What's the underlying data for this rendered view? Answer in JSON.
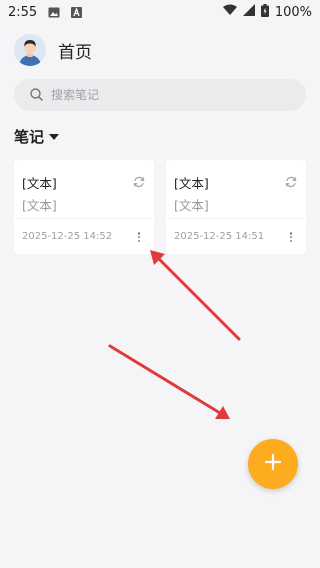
{
  "status_bar": {
    "time": "2:55",
    "battery": "100%"
  },
  "header": {
    "title": "首页"
  },
  "search": {
    "placeholder": "搜索笔记"
  },
  "section": {
    "title": "笔记"
  },
  "notes": [
    {
      "title": "[文本]",
      "body": "[文本]",
      "date": "2025-12-25 14:52"
    },
    {
      "title": "[文本]",
      "body": "[文本]",
      "date": "2025-12-25 14:51"
    }
  ],
  "colors": {
    "accent": "#fdab1f",
    "annotation_arrow": "#e03a3a"
  },
  "icons": [
    "image-icon",
    "a-icon",
    "wifi-icon",
    "signal-icon",
    "battery-icon",
    "avatar",
    "search-icon",
    "caret-down-icon",
    "sync-icon",
    "more-vert-icon",
    "plus-icon"
  ]
}
